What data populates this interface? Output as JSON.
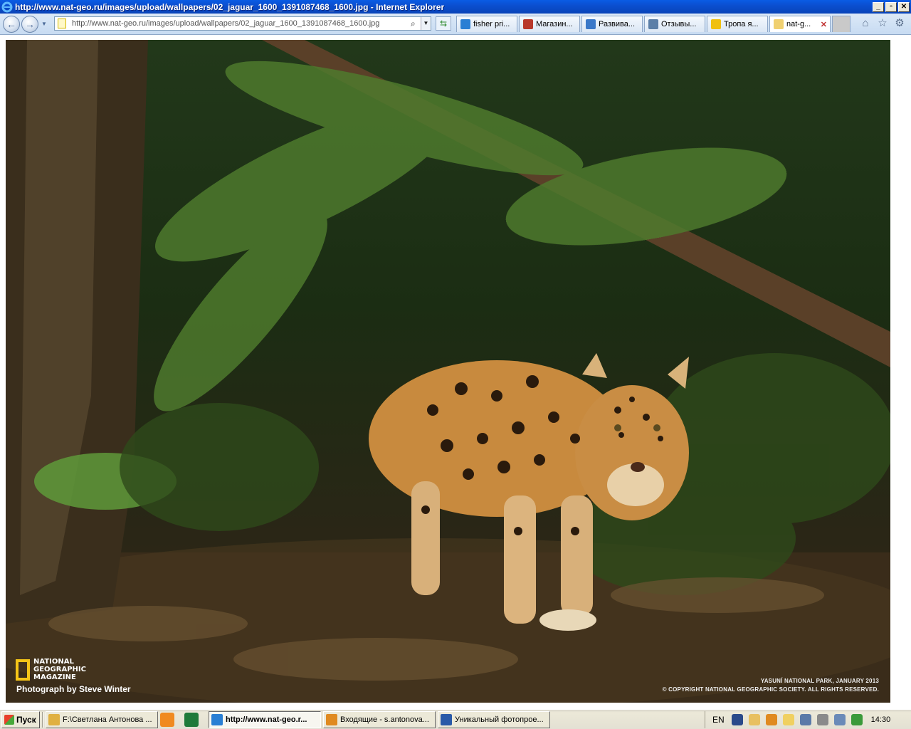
{
  "window": {
    "title": "http://www.nat-geo.ru/images/upload/wallpapers/02_jaguar_1600_1391087468_1600.jpg - Internet Explorer",
    "minimize": "_",
    "maximize": "▫",
    "close": "✕"
  },
  "nav": {
    "address": "http://www.nat-geo.ru/images/upload/wallpapers/02_jaguar_1600_1391087468_1600.jpg"
  },
  "tabs": [
    {
      "label": "fisher pri...",
      "color": "#2a7fd4"
    },
    {
      "label": "Магазин...",
      "color": "#b8382a"
    },
    {
      "label": "Развива...",
      "color": "#3a78c8"
    },
    {
      "label": "Отзывы...",
      "color": "#5b7fa8"
    },
    {
      "label": "Тропа я...",
      "color": "#f0c010"
    },
    {
      "label": "nat-g...",
      "color": "#f0d070"
    }
  ],
  "photo": {
    "logo_lines": [
      "NATIONAL",
      "GEOGRAPHIC",
      "MAGAZINE"
    ],
    "credit": "Photograph by Steve Winter",
    "park": "YASUNÍ NATIONAL PARK, JANUARY 2013",
    "copyright": "© COPYRIGHT NATIONAL GEOGRAPHIC SOCIETY. ALL RIGHTS RESERVED."
  },
  "taskbar": {
    "start": "Пуск",
    "tasks": [
      {
        "label": "F:\\Светлана Антонова ...",
        "color": "#e0b040"
      },
      {
        "label": "http://www.nat-geo.r...",
        "color": "#2a7fd4"
      },
      {
        "label": "Входящие - s.antonova...",
        "color": "#e08a20"
      },
      {
        "label": "Уникальный фотопрое...",
        "color": "#2a5aa8"
      }
    ],
    "lang": "EN",
    "clock": "14:30"
  }
}
